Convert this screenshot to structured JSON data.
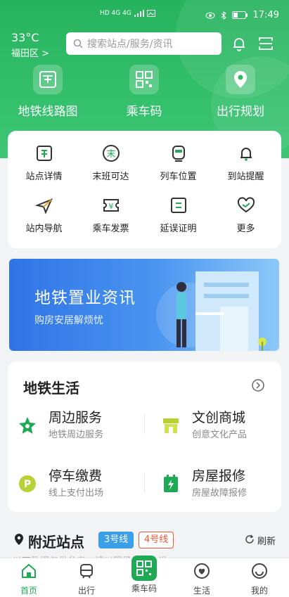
{
  "status_bar": {
    "time": "17:49",
    "left_icons": "HD 4G 4G"
  },
  "header": {
    "temperature": "33°C",
    "district": "福田区 >",
    "search_placeholder": "搜索站点/服务/资讯"
  },
  "quick_actions": [
    {
      "label": "地铁线路图",
      "icon": "metro-map-icon"
    },
    {
      "label": "乘车码",
      "icon": "qr-code-icon"
    },
    {
      "label": "出行规划",
      "icon": "location-pin-icon"
    }
  ],
  "grid_items": [
    {
      "label": "站点详情",
      "icon": "station-icon"
    },
    {
      "label": "末班可达",
      "icon": "last-train-icon"
    },
    {
      "label": "列车位置",
      "icon": "train-icon"
    },
    {
      "label": "到站提醒",
      "icon": "bell-icon"
    },
    {
      "label": "站内导航",
      "icon": "navigation-icon"
    },
    {
      "label": "乘车发票",
      "icon": "invoice-icon"
    },
    {
      "label": "延误证明",
      "icon": "certificate-icon"
    },
    {
      "label": "更多",
      "icon": "more-icon"
    }
  ],
  "banner": {
    "title": "地铁置业资讯",
    "subtitle": "购房安居解烦忧"
  },
  "life": {
    "title": "地铁生活",
    "items": [
      {
        "name": "周边服务",
        "desc": "地铁周边服务",
        "icon": "star-icon",
        "color": "#1eaa55"
      },
      {
        "name": "文创商城",
        "desc": "创意文化产品",
        "icon": "shop-icon",
        "color": "#b6d234"
      },
      {
        "name": "停车缴费",
        "desc": "线上支付出场",
        "icon": "parking-icon",
        "color": "#b6d234"
      },
      {
        "name": "房屋报修",
        "desc": "房屋故障报修",
        "icon": "repair-icon",
        "color": "#1eaa55"
      }
    ]
  },
  "nearby": {
    "title": "附近站点",
    "line3": "3号线",
    "line4": "4号线",
    "refresh": "刷新",
    "notice": "以下数据仅供参考，请以现场信息为准"
  },
  "tabs": [
    {
      "label": "首页",
      "icon": "home-icon"
    },
    {
      "label": "出行",
      "icon": "bus-icon"
    },
    {
      "label": "乘车码",
      "icon": "qr-code-icon"
    },
    {
      "label": "生活",
      "icon": "heart-icon"
    },
    {
      "label": "我的",
      "icon": "smile-icon"
    }
  ],
  "colors": {
    "primary": "#2fb866",
    "line3": "#3a9ee8",
    "line4": "#e85a3a"
  }
}
